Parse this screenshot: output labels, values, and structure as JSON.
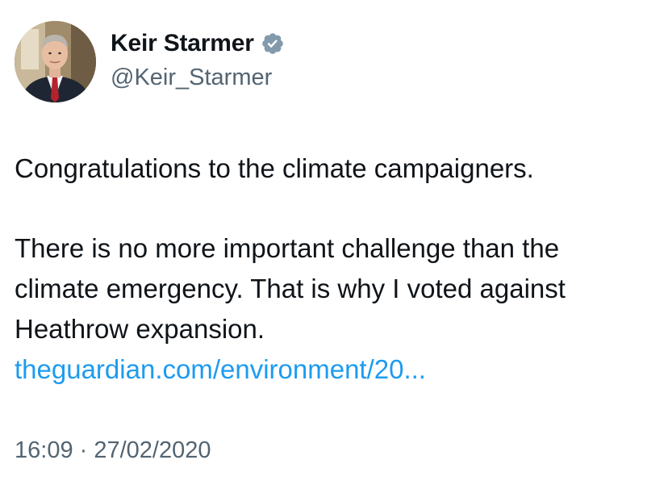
{
  "author": {
    "display_name": "Keir Starmer",
    "handle": "@Keir_Starmer",
    "verified_icon": "verified-badge-icon",
    "badge_color": "#829aab"
  },
  "tweet": {
    "paragraph_1": "Congratulations to the climate campaigners.",
    "paragraph_2_line_1": "There is no more important challenge than the",
    "paragraph_2_line_2": "climate emergency. That is why I voted against",
    "paragraph_2_line_3": "Heathrow expansion.",
    "link_text": "theguardian.com/environment/20...",
    "link_color": "#1d9bf0"
  },
  "meta": {
    "time": "16:09",
    "separator": " · ",
    "date": "27/02/2020"
  }
}
